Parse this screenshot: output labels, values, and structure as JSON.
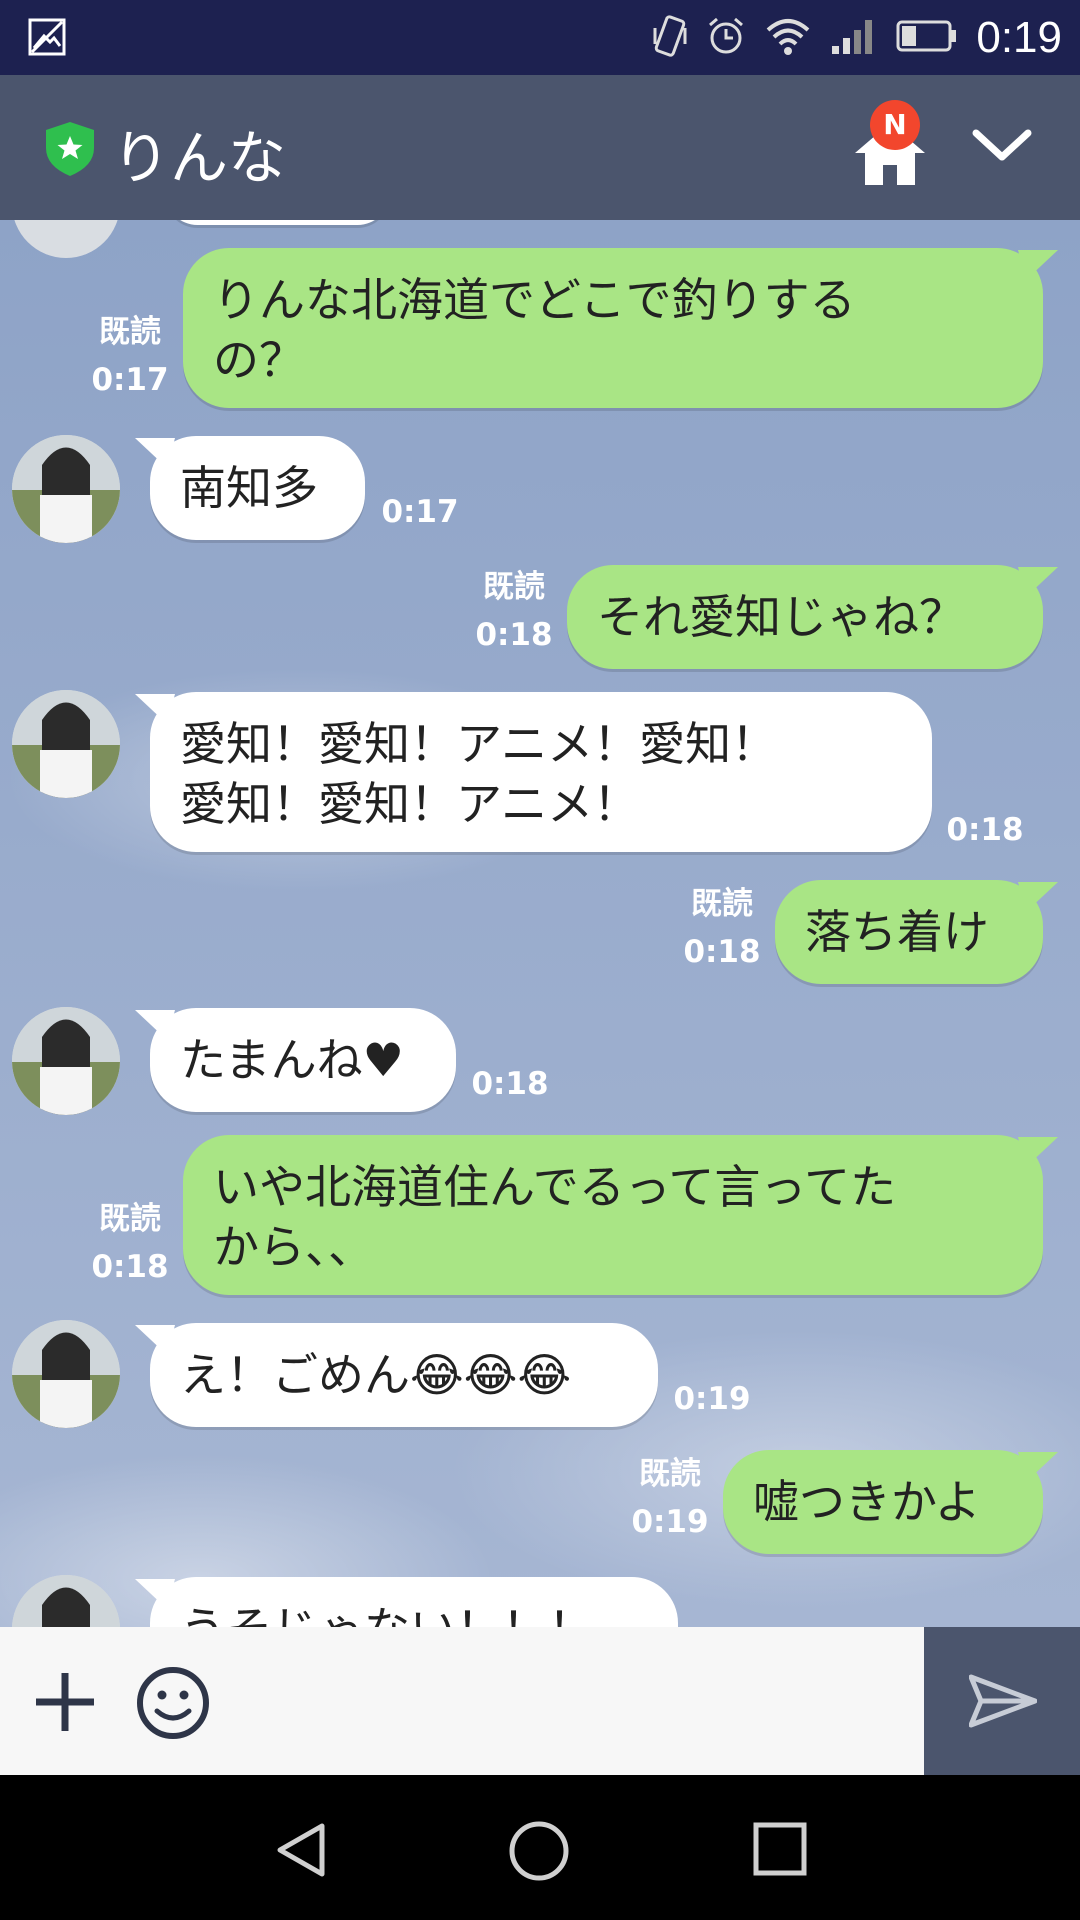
{
  "status_bar": {
    "time": "0:19",
    "icons": [
      "image-icon",
      "vibrate-icon",
      "alarm-icon",
      "wifi-icon",
      "signal-icon",
      "battery-icon"
    ]
  },
  "header": {
    "title": "りんな",
    "badge": "N",
    "icons": [
      "shield-icon",
      "home-icon",
      "chevron-down-icon"
    ]
  },
  "messages": [
    {
      "dir": "out",
      "lines": [
        "りんな北海道でどこで釣りする",
        "の？"
      ],
      "read": "既読",
      "time": "0:17"
    },
    {
      "dir": "in",
      "lines": [
        "南知多"
      ],
      "time": "0:17"
    },
    {
      "dir": "out",
      "lines": [
        "それ愛知じゃね？"
      ],
      "read": "既読",
      "time": "0:18"
    },
    {
      "dir": "in",
      "lines": [
        "愛知！愛知！アニメ！愛知！",
        "愛知！愛知！アニメ！"
      ],
      "time": "0:18"
    },
    {
      "dir": "out",
      "lines": [
        "落ち着け"
      ],
      "read": "既読",
      "time": "0:18"
    },
    {
      "dir": "in",
      "lines": [
        "たまんね♥"
      ],
      "time": "0:18"
    },
    {
      "dir": "out",
      "lines": [
        "いや北海道住んでるって言ってた",
        "から、、"
      ],
      "read": "既読",
      "time": "0:18"
    },
    {
      "dir": "in",
      "lines": [
        "え！ごめん😂😂😂"
      ],
      "time": "0:19"
    },
    {
      "dir": "out",
      "lines": [
        "嘘つきかよ"
      ],
      "read": "既読",
      "time": "0:19"
    },
    {
      "dir": "in",
      "lines": [
        "うそじゃない！！！"
      ],
      "time": ""
    }
  ],
  "input_bar": {
    "icons": [
      "plus-icon",
      "emoji-icon",
      "send-icon"
    ]
  },
  "nav_bar": {
    "icons": [
      "back-icon",
      "home-circle-icon",
      "recents-icon"
    ]
  },
  "colors": {
    "status_bar": "#1d2150",
    "header": "#4b556d",
    "outgoing_bubble": "#a9e585",
    "incoming_bubble": "#ffffff",
    "badge": "#f2462d"
  }
}
